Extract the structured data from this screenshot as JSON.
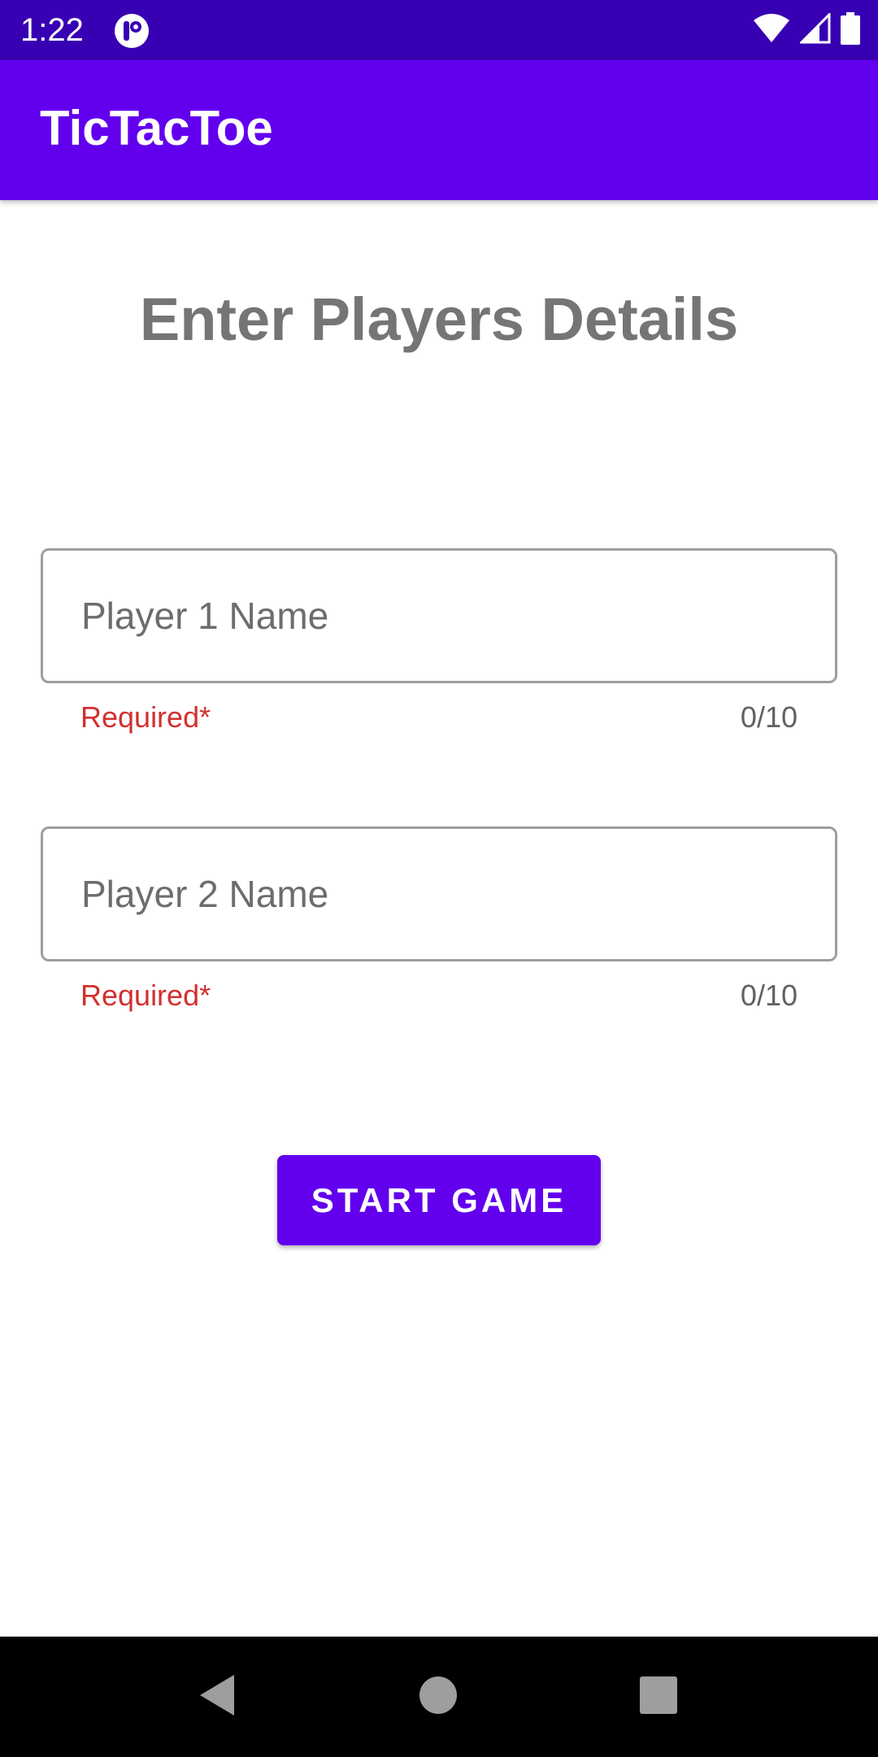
{
  "status_bar": {
    "time": "1:22",
    "icons": [
      "app-notification-icon",
      "wifi-icon",
      "cell-signal-icon",
      "battery-icon"
    ],
    "background": "#3700b3"
  },
  "app_bar": {
    "title": "TicTacToe",
    "background": "#6200ee"
  },
  "main": {
    "title": "Enter Players Details",
    "fields": [
      {
        "placeholder": "Player 1 Name",
        "value": "",
        "helper": "Required*",
        "counter": "0/10"
      },
      {
        "placeholder": "Player 2 Name",
        "value": "",
        "helper": "Required*",
        "counter": "0/10"
      }
    ],
    "start_button": {
      "label": "START GAME",
      "color": "#6200ee"
    }
  },
  "nav_bar": {
    "buttons": [
      "back-icon",
      "home-icon",
      "recents-icon"
    ]
  },
  "colors": {
    "error": "#d32f2f",
    "accent": "#6200ee"
  }
}
